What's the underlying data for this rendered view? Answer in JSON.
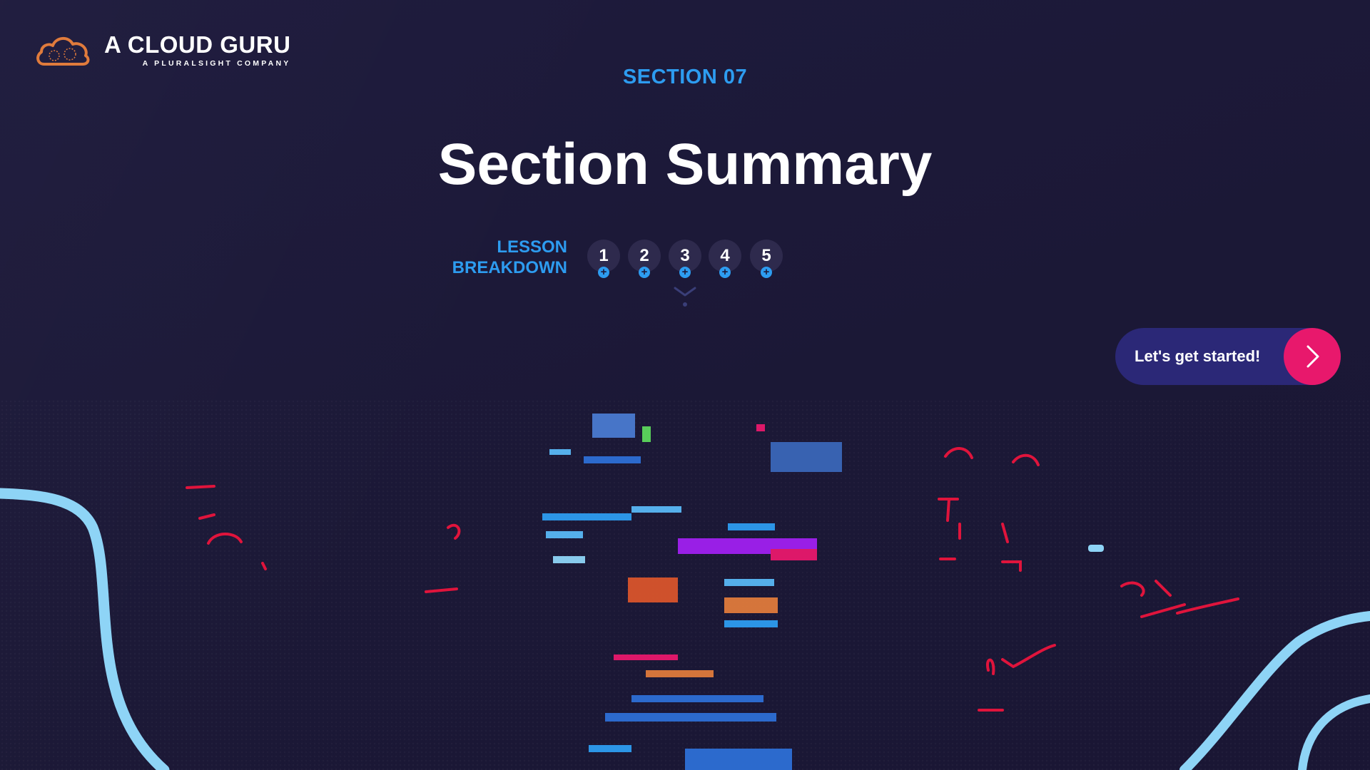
{
  "brand": {
    "name": "A CLOUD GURU",
    "tagline": "A PLURALSIGHT COMPANY",
    "logo_icon": "cloud-logo-icon",
    "logo_color": "#e07b3c"
  },
  "section": {
    "label": "SECTION 07",
    "title": "Section Summary"
  },
  "breakdown": {
    "label_line1": "LESSON",
    "label_line2": "BREAKDOWN",
    "lessons": [
      {
        "number": "1"
      },
      {
        "number": "2"
      },
      {
        "number": "3"
      },
      {
        "number": "4"
      },
      {
        "number": "5"
      }
    ],
    "expand_icon": "chevron-down-icon"
  },
  "cta": {
    "label": "Let's get started!",
    "icon": "chevron-right-icon"
  },
  "colors": {
    "background": "#1d1a3a",
    "accent_blue": "#2d9cf0",
    "cta_bg": "#2b2877",
    "cta_arrow": "#e8186c",
    "lesson_bubble": "#2e2a4d",
    "squiggle": "#8ed4f6",
    "glitch_red": "#e0143c"
  }
}
